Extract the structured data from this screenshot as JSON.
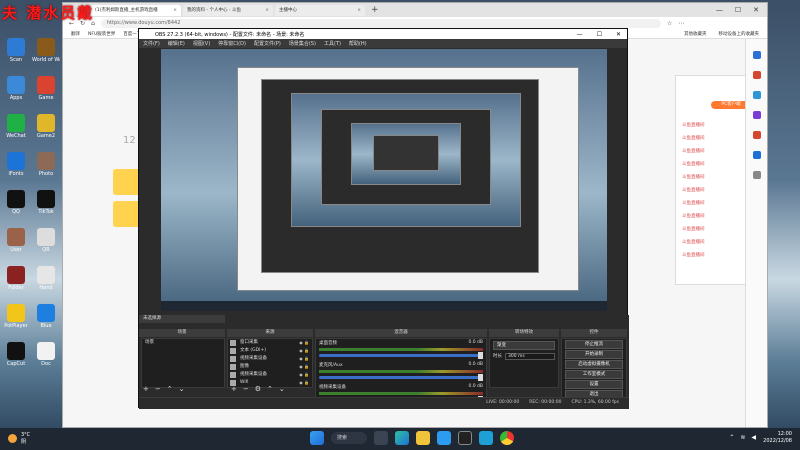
{
  "watermark": "夫 潜水员戴",
  "desktop_icons": [
    {
      "label": "Scan",
      "color": "#2e7bd6"
    },
    {
      "label": "World of Warcraft",
      "color": "#8a5a1a"
    },
    {
      "label": "Apps",
      "color": "#3b8ad8"
    },
    {
      "label": "Game",
      "color": "#d9432f"
    },
    {
      "label": "WeChat",
      "color": "#1fb046"
    },
    {
      "label": "Game2",
      "color": "#e0b72b"
    },
    {
      "label": "iFonts",
      "color": "#1e73d6"
    },
    {
      "label": "Photo",
      "color": "#8d6a55"
    },
    {
      "label": "QQ",
      "color": "#111111"
    },
    {
      "label": "TikTok",
      "color": "#111111"
    },
    {
      "label": "User",
      "color": "#9a6248"
    },
    {
      "label": "QR",
      "color": "#dddddd"
    },
    {
      "label": "Folder",
      "color": "#8a2222"
    },
    {
      "label": "Hand",
      "color": "#e6e6e6"
    },
    {
      "label": "PotPlayer",
      "color": "#f3c41a"
    },
    {
      "label": "Blue",
      "color": "#1e7fe0"
    },
    {
      "label": "CapCut",
      "color": "#111111"
    },
    {
      "label": "Doc",
      "color": "#f2f2f2"
    }
  ],
  "browser": {
    "tabs": [
      {
        "label": "(1)杰利姆斯直播_主机游戏直播",
        "active": true
      },
      {
        "label": "我的资料 - 个人中心 - 斗鱼",
        "active": false
      },
      {
        "label": "主播中心",
        "active": false
      }
    ],
    "new_tab": "+",
    "url": "https://www.douyu.com/8442",
    "bookmarks": [
      "翻译",
      "NFU服装世界",
      "百度一下",
      "导航"
    ],
    "bookmarks_right": [
      "其他收藏夹",
      "移动设备上的收藏夹"
    ],
    "page_num": "12",
    "live_button": "PC客户端",
    "live_list": [
      "斗鱼直播间",
      "斗鱼直播间",
      "斗鱼直播间",
      "斗鱼直播间",
      "斗鱼直播间",
      "斗鱼直播间",
      "斗鱼直播间",
      "斗鱼直播间",
      "斗鱼直播间",
      "斗鱼直播间",
      "斗鱼直播间"
    ]
  },
  "obs": {
    "title": "OBS 27.2.3 (64-bit, windows) - 配置文件: 未命名 - 场景: 未命名",
    "menu": [
      "文件(F)",
      "编辑(E)",
      "视图(V)",
      "停靠窗口(D)",
      "配置文件(P)",
      "场景集合(S)",
      "工具(T)",
      "帮助(H)"
    ],
    "preview_toolbar": "未选择源",
    "docks": {
      "scenes": "场景",
      "sources": "来源",
      "mixer": "混音器",
      "transitions": "转场特效",
      "controls": "控件"
    },
    "scene_items": [
      "场景"
    ],
    "source_items": [
      "窗口采集",
      "文本 (GDI+)",
      "视频采集设备",
      "图像",
      "视频采集设备",
      "Wifi"
    ],
    "mixer_rows": [
      {
        "name": "桌面音频",
        "db": "0.0 dB"
      },
      {
        "name": "麦克风/Aux",
        "db": "0.0 dB"
      },
      {
        "name": "视频采集设备",
        "db": "0.0 dB"
      }
    ],
    "transition": {
      "type": "渐变",
      "duration_label": "时长",
      "duration": "300 ms"
    },
    "controls": [
      "停止推流",
      "开始录制",
      "启动虚拟摄像机",
      "工作室模式",
      "设置",
      "退出"
    ],
    "status": [
      "LIVE: 00:00:00",
      "REC: 00:00:00",
      "CPU: 1.3%, 60.00 fps"
    ]
  },
  "taskbar": {
    "weather_temp": "3°C",
    "weather_text": "阴",
    "search_label": "搜索",
    "time": "12:00",
    "date": "2022/12/08"
  }
}
